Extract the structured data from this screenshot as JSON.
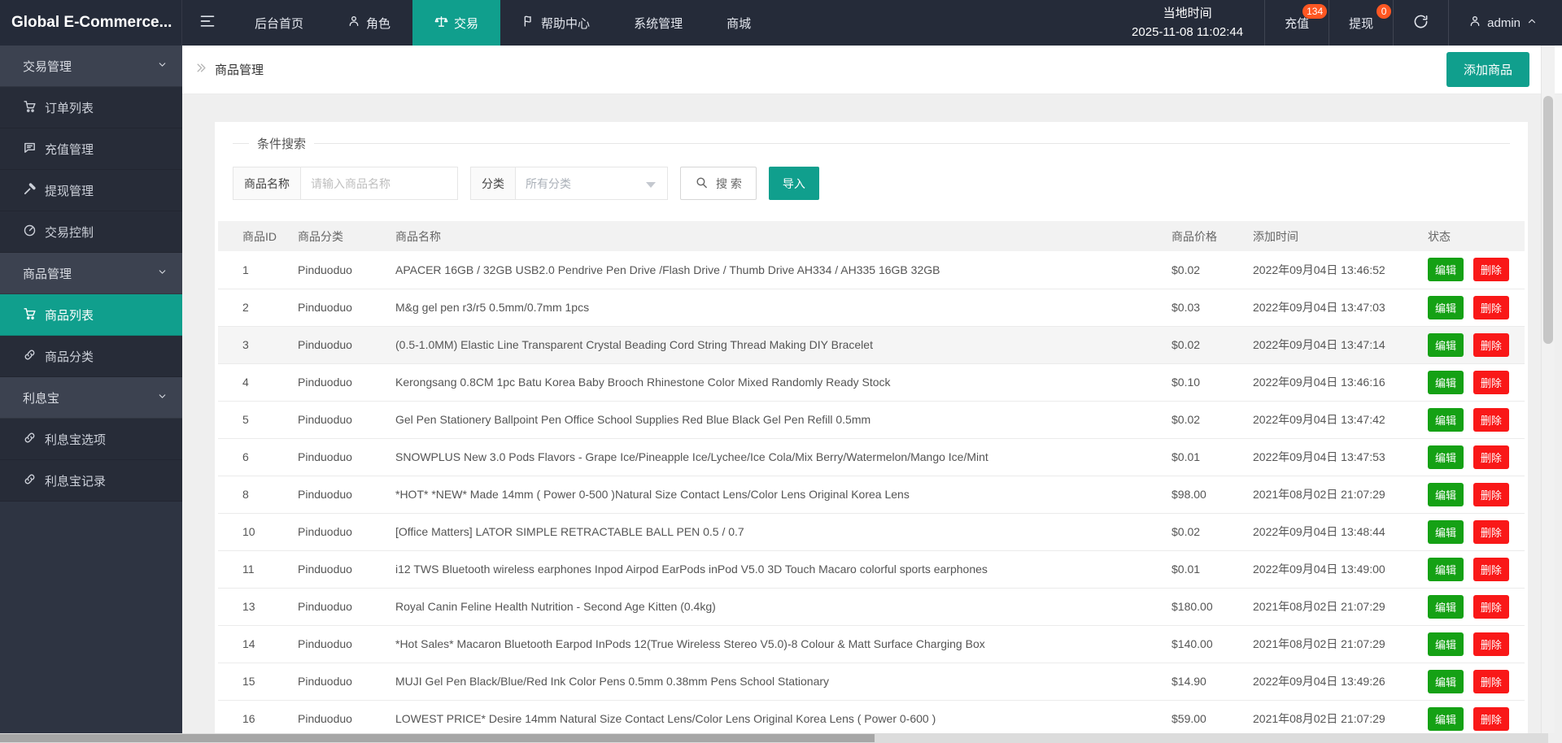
{
  "colors": {
    "accent": "#109f8d",
    "edit_green": "#15a115",
    "delete_red": "#f91818",
    "badge_orange": "#ff5722"
  },
  "app": {
    "logo": "Global E-Commerce..."
  },
  "topnav": {
    "items": [
      {
        "label": "后台首页"
      },
      {
        "label": "角色",
        "icon": "user-icon"
      },
      {
        "label": "交易",
        "icon": "scales-icon",
        "active": true
      },
      {
        "label": "帮助中心",
        "icon": "flag-icon"
      },
      {
        "label": "系统管理"
      },
      {
        "label": "商城"
      }
    ],
    "time": {
      "label": "当地时间",
      "value": "2025-11-08 11:02:44"
    },
    "recharge": {
      "label": "充值",
      "badge": "134"
    },
    "withdraw": {
      "label": "提现",
      "badge": "0"
    },
    "user": {
      "name": "admin"
    }
  },
  "sidebar": {
    "items": [
      {
        "label": "交易管理",
        "type": "header"
      },
      {
        "label": "订单列表",
        "icon": "cart-icon"
      },
      {
        "label": "充值管理",
        "icon": "comment-icon"
      },
      {
        "label": "提现管理",
        "icon": "gavel-icon"
      },
      {
        "label": "交易控制",
        "icon": "gauge-icon"
      },
      {
        "label": "商品管理",
        "type": "header"
      },
      {
        "label": "商品列表",
        "icon": "cart-icon",
        "active": true
      },
      {
        "label": "商品分类",
        "icon": "link-icon"
      },
      {
        "label": "利息宝",
        "type": "header"
      },
      {
        "label": "利息宝选项",
        "icon": "link-icon"
      },
      {
        "label": "利息宝记录",
        "icon": "link-icon"
      }
    ]
  },
  "breadcrumb": {
    "title": "商品管理"
  },
  "actions": {
    "add_product": "添加商品"
  },
  "search": {
    "legend": "条件搜索",
    "name_label": "商品名称",
    "name_placeholder": "请输入商品名称",
    "name_value": "",
    "category_label": "分类",
    "category_value": "所有分类",
    "search_label": "搜 索",
    "import_label": "导入"
  },
  "table": {
    "columns": [
      "商品ID",
      "商品分类",
      "商品名称",
      "商品价格",
      "添加时间",
      "状态"
    ],
    "edit_label": "编辑",
    "delete_label": "删除",
    "rows": [
      {
        "id": "1",
        "category": "Pinduoduo",
        "name": "APACER 16GB / 32GB USB2.0 Pendrive Pen Drive /Flash Drive / Thumb Drive AH334 / AH335 16GB 32GB",
        "price": "$0.02",
        "time": "2022年09月04日 13:46:52"
      },
      {
        "id": "2",
        "category": "Pinduoduo",
        "name": "M&g gel pen r3/r5 0.5mm/0.7mm 1pcs",
        "price": "$0.03",
        "time": "2022年09月04日 13:47:03"
      },
      {
        "id": "3",
        "category": "Pinduoduo",
        "name": "(0.5-1.0MM) Elastic Line Transparent Crystal Beading Cord String Thread Making DIY Bracelet",
        "price": "$0.02",
        "time": "2022年09月04日 13:47:14",
        "highlight": true
      },
      {
        "id": "4",
        "category": "Pinduoduo",
        "name": "Kerongsang 0.8CM 1pc Batu Korea Baby Brooch Rhinestone Color Mixed Randomly Ready Stock",
        "price": "$0.10",
        "time": "2022年09月04日 13:46:16"
      },
      {
        "id": "5",
        "category": "Pinduoduo",
        "name": "Gel Pen Stationery Ballpoint Pen Office School Supplies Red Blue Black Gel Pen Refill 0.5mm",
        "price": "$0.02",
        "time": "2022年09月04日 13:47:42"
      },
      {
        "id": "6",
        "category": "Pinduoduo",
        "name": "SNOWPLUS New 3.0 Pods Flavors - Grape Ice/Pineapple Ice/Lychee/Ice Cola/Mix Berry/Watermelon/Mango Ice/Mint",
        "price": "$0.01",
        "time": "2022年09月04日 13:47:53"
      },
      {
        "id": "8",
        "category": "Pinduoduo",
        "name": "*HOT* *NEW* Made 14mm ( Power 0-500 )Natural Size Contact Lens/Color Lens Original Korea Lens",
        "price": "$98.00",
        "time": "2021年08月02日 21:07:29"
      },
      {
        "id": "10",
        "category": "Pinduoduo",
        "name": "[Office Matters] LATOR SIMPLE RETRACTABLE BALL PEN 0.5 / 0.7",
        "price": "$0.02",
        "time": "2022年09月04日 13:48:44"
      },
      {
        "id": "11",
        "category": "Pinduoduo",
        "name": "i12 TWS Bluetooth wireless earphones Inpod Airpod EarPods inPod V5.0 3D Touch Macaro colorful sports earphones",
        "price": "$0.01",
        "time": "2022年09月04日 13:49:00"
      },
      {
        "id": "13",
        "category": "Pinduoduo",
        "name": "Royal Canin Feline Health Nutrition - Second Age Kitten (0.4kg)",
        "price": "$180.00",
        "time": "2021年08月02日 21:07:29"
      },
      {
        "id": "14",
        "category": "Pinduoduo",
        "name": "*Hot Sales* Macaron Bluetooth Earpod InPods 12(True Wireless Stereo V5.0)-8 Colour & Matt Surface Charging Box",
        "price": "$140.00",
        "time": "2021年08月02日 21:07:29"
      },
      {
        "id": "15",
        "category": "Pinduoduo",
        "name": "MUJI Gel Pen Black/Blue/Red Ink Color Pens 0.5mm 0.38mm Pens School Stationary",
        "price": "$14.90",
        "time": "2022年09月04日 13:49:26"
      },
      {
        "id": "16",
        "category": "Pinduoduo",
        "name": "LOWEST PRICE* Desire 14mm Natural Size Contact Lens/Color Lens Original Korea Lens ( Power 0-600 )",
        "price": "$59.00",
        "time": "2021年08月02日 21:07:29"
      }
    ]
  }
}
